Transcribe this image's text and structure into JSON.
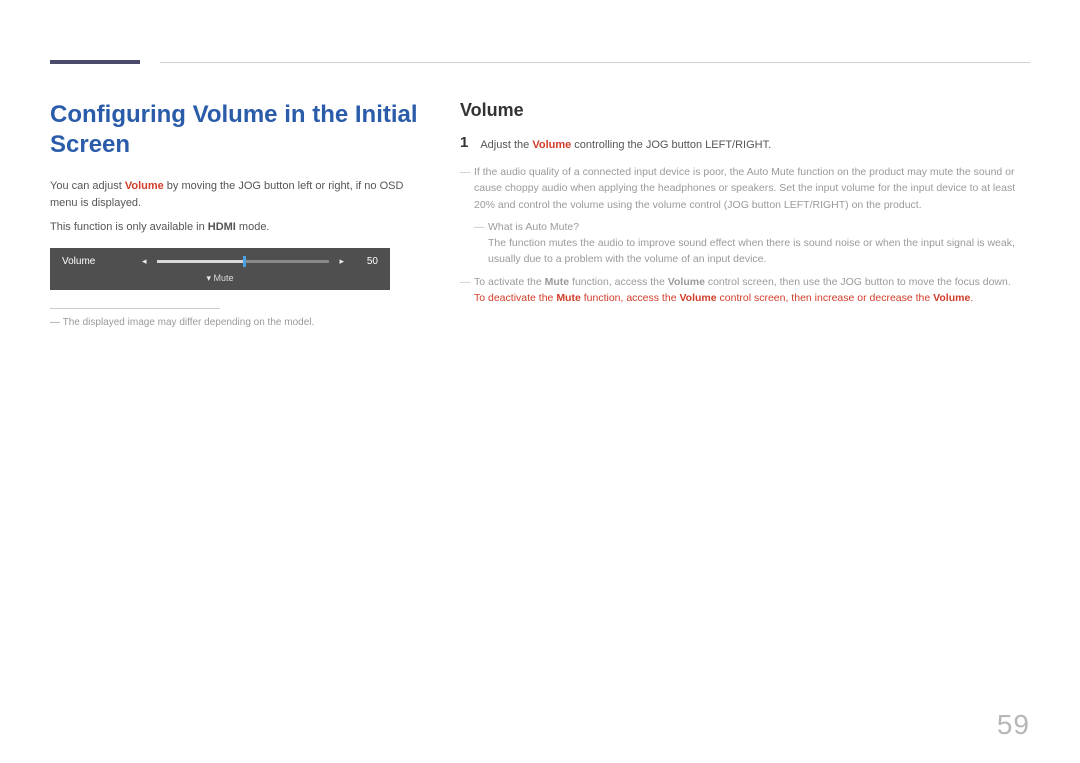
{
  "page_number": "59",
  "left": {
    "heading": "Configuring Volume in the Initial Screen",
    "intro_pre": "You can adjust ",
    "intro_hl": "Volume",
    "intro_post": " by moving the JOG button left or right, if no OSD menu is displayed.",
    "mode_pre": "This function is only available in ",
    "mode_hl": "HDMI",
    "mode_post": " mode.",
    "osd": {
      "label": "Volume",
      "value": "50",
      "mute_label": "Mute",
      "down_glyph": "▾",
      "left_glyph": "◂",
      "right_glyph": "▸"
    },
    "disclaimer": "The displayed image may differ depending on the model."
  },
  "right": {
    "heading": "Volume",
    "step1": {
      "num": "1",
      "pre": "Adjust the ",
      "hl": "Volume",
      "post": " controlling the JOG button LEFT/RIGHT."
    },
    "note_quality": "If the audio quality of a connected input device is poor, the Auto Mute function on the product may mute the sound or cause choppy audio when applying the headphones or speakers. Set the input volume for the input device to at least 20% and control the volume using the volume control (JOG button LEFT/RIGHT) on the product.",
    "automute_q": "What is Auto Mute?",
    "automute_a": "The function mutes the audio to improve sound effect when there is sound noise or when the input signal is weak, usually due to a problem with the volume of an input device.",
    "mute": {
      "activate_pre": "To activate the ",
      "mute_hl": "Mute",
      "activate_mid": " function, access the ",
      "volume_hl": "Volume",
      "activate_post": " control screen, then use the JOG button to move the focus down.",
      "deact_pre": "To deactivate the ",
      "deact_mid": " function, access the ",
      "deact_mid2": " control screen, then increase or decrease the ",
      "deact_end": "."
    }
  }
}
